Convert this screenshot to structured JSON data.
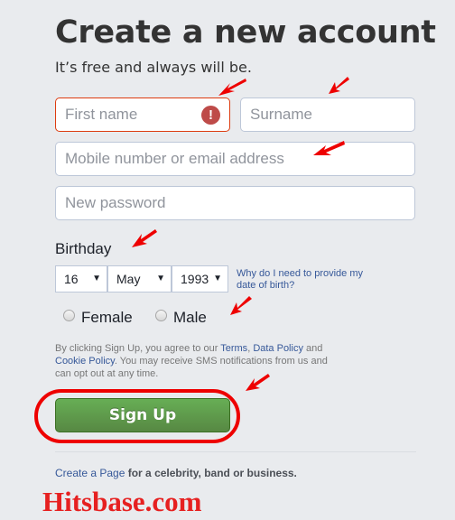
{
  "header": {
    "title": "Create a new account",
    "subtitle": "It’s free and always will be."
  },
  "form": {
    "first_name": {
      "placeholder": "First name",
      "value": "",
      "state": "error",
      "icon": "error-exclamation-icon",
      "icon_glyph": "!"
    },
    "surname": {
      "placeholder": "Surname",
      "value": ""
    },
    "contact": {
      "placeholder": "Mobile number or email address",
      "value": ""
    },
    "password": {
      "placeholder": "New password",
      "value": ""
    },
    "birthday": {
      "label": "Birthday",
      "day": "16",
      "month": "May",
      "year": "1993",
      "arrow_glyph": "▼",
      "why_link": "Why do I need to provide my date of birth?"
    },
    "gender": {
      "options": [
        "Female",
        "Male"
      ],
      "selected": null
    },
    "terms": {
      "prefix": "By clicking Sign Up, you agree to our ",
      "terms_link": "Terms",
      "sep": ", ",
      "data_policy_link": "Data Policy",
      "and": " and ",
      "cookie_policy_link": "Cookie Policy",
      "suffix": ". You may receive SMS notifications from us and can opt out at any time."
    },
    "signup_label": "Sign Up",
    "signup_color": "#5b9a48"
  },
  "footer": {
    "create_page_link": "Create a Page",
    "create_page_text": " for a celebrity, band or business."
  },
  "watermark": "Hitsbase.com",
  "annotation_color": "#ee0000"
}
